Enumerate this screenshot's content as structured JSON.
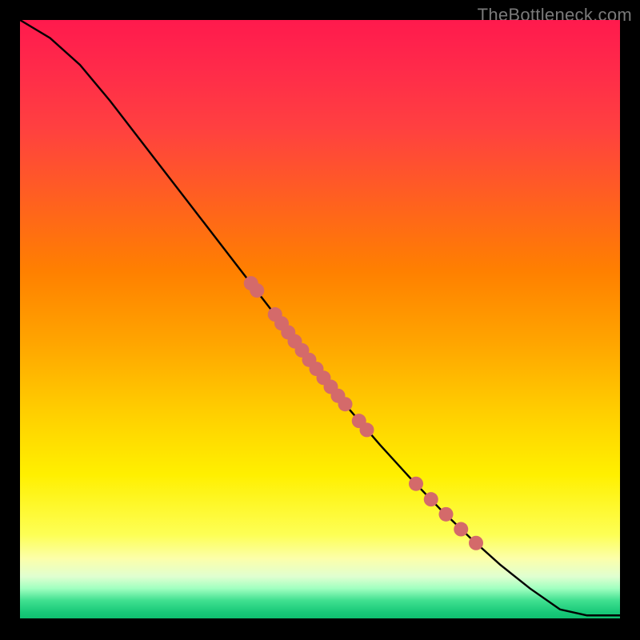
{
  "watermark": "TheBottleneck.com",
  "chart_data": {
    "type": "line",
    "title": "",
    "xlabel": "",
    "ylabel": "",
    "xlim": [
      0,
      100
    ],
    "ylim": [
      0,
      100
    ],
    "series": [
      {
        "name": "curve",
        "x": [
          0,
          5,
          10,
          15,
          20,
          25,
          30,
          35,
          40,
          45,
          50,
          55,
          60,
          65,
          70,
          75,
          80,
          85,
          90,
          94.5,
          100
        ],
        "y": [
          100,
          97,
          92.5,
          86.5,
          80,
          73.5,
          67,
          60.5,
          54,
          47.5,
          41,
          34.8,
          29,
          23.5,
          18.3,
          13.5,
          9,
          5,
          1.5,
          0.5,
          0.5
        ]
      }
    ],
    "points": {
      "name": "markers",
      "color": "#d46a6a",
      "radius_px": 9,
      "data": [
        {
          "x": 38.5,
          "y": 56.0
        },
        {
          "x": 39.5,
          "y": 54.8
        },
        {
          "x": 42.5,
          "y": 50.8
        },
        {
          "x": 43.6,
          "y": 49.3
        },
        {
          "x": 44.7,
          "y": 47.8
        },
        {
          "x": 45.8,
          "y": 46.3
        },
        {
          "x": 47.0,
          "y": 44.8
        },
        {
          "x": 48.2,
          "y": 43.2
        },
        {
          "x": 49.4,
          "y": 41.7
        },
        {
          "x": 50.6,
          "y": 40.2
        },
        {
          "x": 51.8,
          "y": 38.7
        },
        {
          "x": 53.0,
          "y": 37.2
        },
        {
          "x": 54.2,
          "y": 35.8
        },
        {
          "x": 56.5,
          "y": 33.0
        },
        {
          "x": 57.8,
          "y": 31.5
        },
        {
          "x": 66.0,
          "y": 22.5
        },
        {
          "x": 68.5,
          "y": 19.9
        },
        {
          "x": 71.0,
          "y": 17.4
        },
        {
          "x": 73.5,
          "y": 14.9
        },
        {
          "x": 76.0,
          "y": 12.6
        }
      ]
    },
    "gradient_colors": {
      "top": "#ff1a4d",
      "mid_upper": "#ff8000",
      "mid": "#ffff00",
      "bottom": "#10c070"
    }
  }
}
